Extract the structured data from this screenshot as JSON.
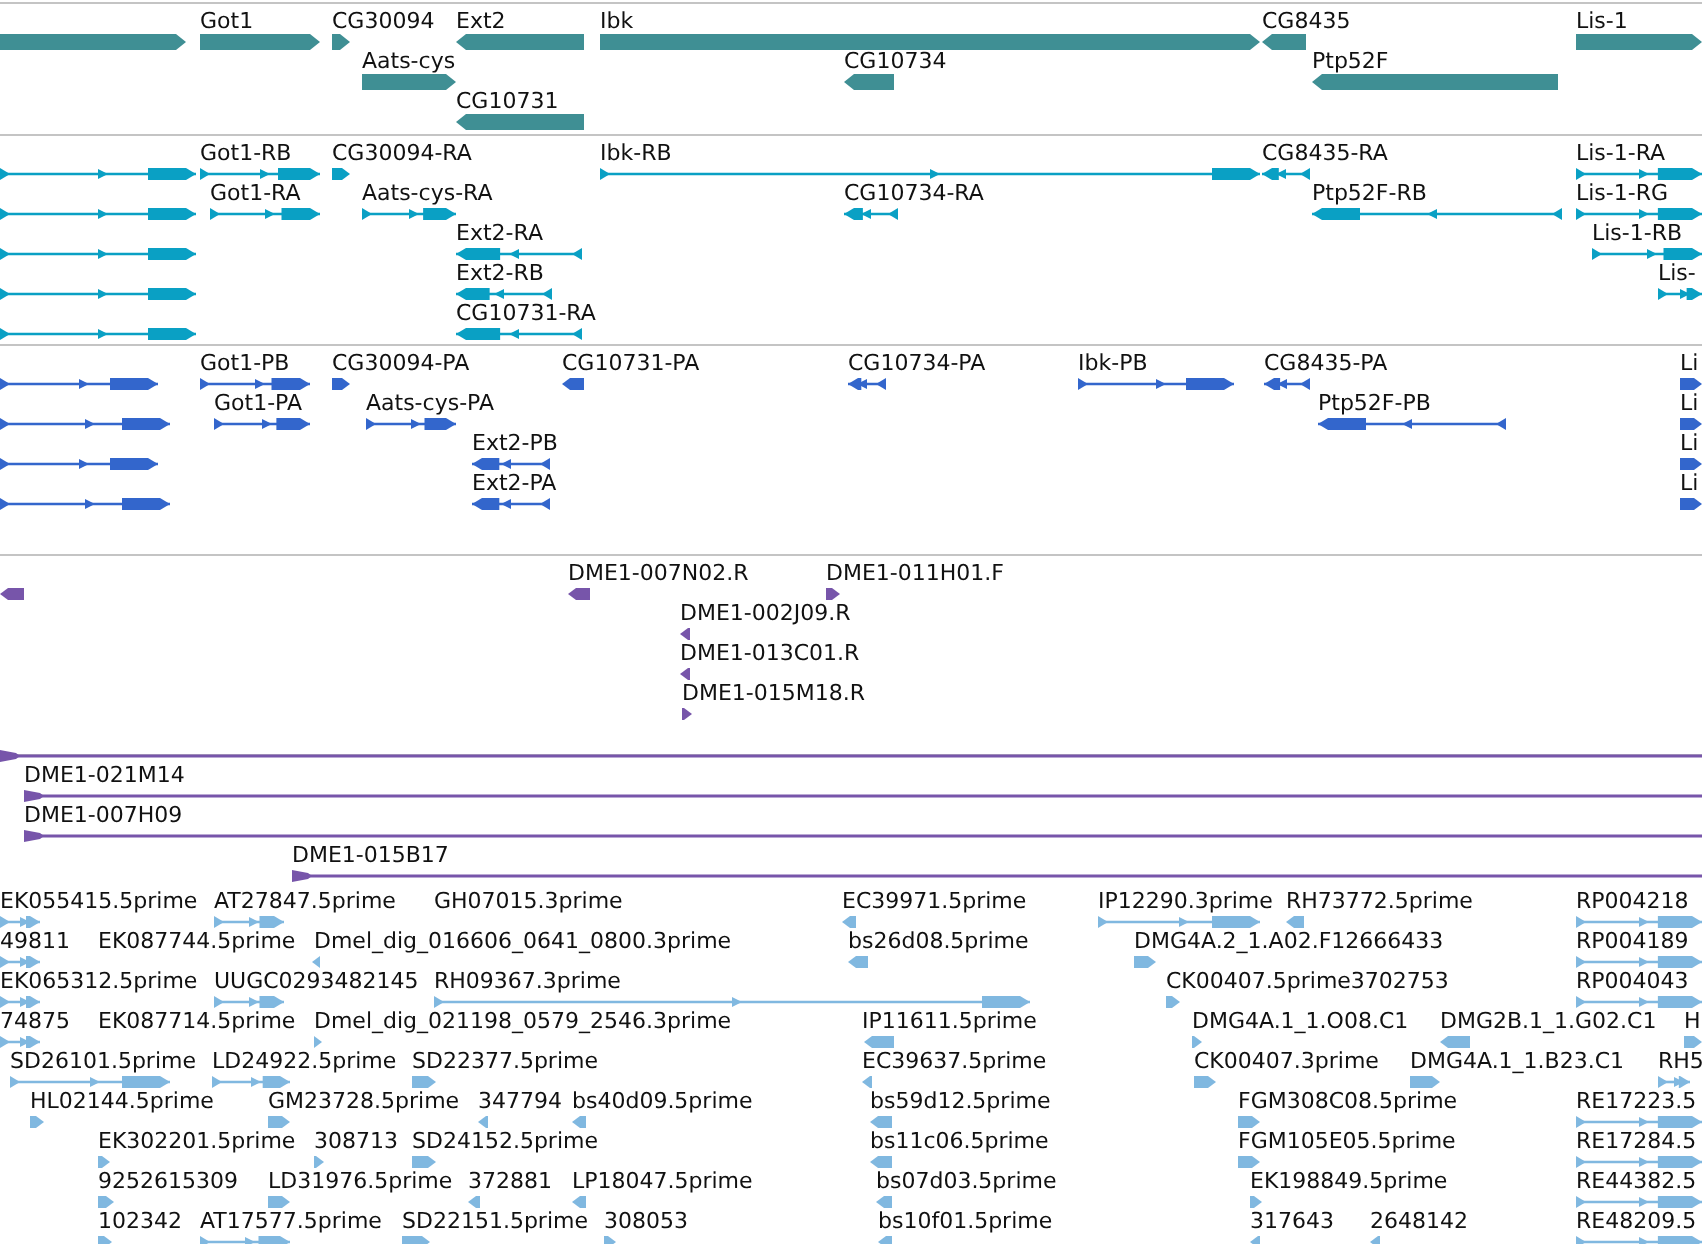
{
  "tracks": [
    {
      "kind": "genes",
      "color": "#3f8f94",
      "features": [
        {
          "forward": true
        },
        {
          "label": "Got1",
          "forward": true
        },
        {
          "label": "CG30094",
          "forward": true
        },
        {
          "label": "Ext2",
          "forward": false
        },
        {
          "label": "Ibk",
          "forward": true
        },
        {
          "label": "CG8435",
          "forward": false
        },
        {
          "label": "Lis-1",
          "forward": true
        },
        {
          "label": "Aats-cys",
          "forward": true
        },
        {
          "label": "CG10734",
          "forward": false
        },
        {
          "label": "Ptp52F",
          "forward": false
        },
        {
          "label": "CG10731",
          "forward": false
        }
      ]
    },
    {
      "kind": "transcripts",
      "color": "#0aa0c4",
      "features": [
        {
          "forward": true
        },
        {
          "forward": true
        },
        {
          "forward": true
        },
        {
          "forward": true
        },
        {
          "forward": true
        },
        {
          "label": "Got1-RB",
          "forward": true
        },
        {
          "label": "CG30094-RA",
          "forward": true
        },
        {
          "label": "Ibk-RB",
          "forward": true
        },
        {
          "label": "CG8435-RA",
          "forward": false
        },
        {
          "label": "Lis-1-RA",
          "forward": true
        },
        {
          "label": "Got1-RA",
          "forward": true
        },
        {
          "label": "Aats-cys-RA",
          "forward": true
        },
        {
          "label": "CG10734-RA",
          "forward": false
        },
        {
          "label": "Ptp52F-RB",
          "forward": false
        },
        {
          "label": "Lis-1-RG",
          "forward": true
        },
        {
          "label": "Ext2-RA",
          "forward": false
        },
        {
          "label": "Lis-1-RB",
          "forward": true
        },
        {
          "label": "Ext2-RB",
          "forward": false
        },
        {
          "label": "Lis-",
          "forward": true
        },
        {
          "label": "CG10731-RA",
          "forward": false
        }
      ]
    },
    {
      "kind": "proteins",
      "color": "#3366cc",
      "features": [
        {
          "forward": true
        },
        {
          "forward": true
        },
        {
          "forward": true
        },
        {
          "forward": true
        },
        {
          "label": "Got1-PB",
          "forward": true
        },
        {
          "label": "CG30094-PA",
          "forward": true
        },
        {
          "label": "CG10731-PA",
          "forward": false
        },
        {
          "label": "CG10734-PA",
          "forward": false
        },
        {
          "label": "Ibk-PB",
          "forward": true
        },
        {
          "label": "CG8435-PA",
          "forward": false
        },
        {
          "label": "Li",
          "forward": true
        },
        {
          "label": "Got1-PA",
          "forward": true
        },
        {
          "label": "Aats-cys-PA",
          "forward": true
        },
        {
          "label": "Ptp52F-PB",
          "forward": false
        },
        {
          "label": "Li",
          "forward": true
        },
        {
          "label": "Ext2-PB",
          "forward": false
        },
        {
          "label": "Li",
          "forward": true
        },
        {
          "label": "Ext2-PA",
          "forward": false
        },
        {
          "label": "Li",
          "forward": true
        }
      ]
    },
    {
      "kind": "bacends",
      "color": "#7755aa",
      "features": [
        {
          "forward": false
        },
        {
          "label": "DME1-007N02.R",
          "forward": false
        },
        {
          "label": "DME1-011H01.F",
          "forward": true
        },
        {
          "label": "DME1-002J09.R",
          "forward": false
        },
        {
          "label": "DME1-013C01.R",
          "forward": false
        },
        {
          "label": "DME1-015M18.R",
          "forward": true
        }
      ]
    },
    {
      "kind": "clones",
      "color": "#7755aa",
      "features": [
        {
          "forward": true
        },
        {
          "label": "DME1-021M14",
          "forward": true
        },
        {
          "label": "DME1-007H09",
          "forward": true
        },
        {
          "label": "DME1-015B17",
          "forward": true
        }
      ]
    },
    {
      "kind": "ests",
      "color": "#80b8e0",
      "features": [
        {
          "label": "EK055415.5prime",
          "forward": true
        },
        {
          "label": "AT27847.5prime",
          "forward": true
        },
        {
          "label": "GH07015.3prime"
        },
        {
          "label": "EC39971.5prime",
          "forward": false
        },
        {
          "label": "IP12290.3prime",
          "forward": true
        },
        {
          "label": "RH73772.5prime",
          "forward": false
        },
        {
          "label": "RP004218",
          "forward": true
        },
        {
          "label": "49811",
          "forward": true
        },
        {
          "label": "EK087744.5prime"
        },
        {
          "label": "Dmel_dig_016606_0641_0800.3prime",
          "forward": false
        },
        {
          "label": "bs26d08.5prime",
          "forward": false
        },
        {
          "label": "DMG4A.2_1.A02.F12666433",
          "forward": true
        },
        {
          "label": "RP004189",
          "forward": true
        },
        {
          "label": "EK065312.5prime",
          "forward": true
        },
        {
          "label": "UUGC0293482145",
          "forward": true
        },
        {
          "label": "RH09367.3prime",
          "forward": true
        },
        {
          "label": "CK00407.5prime3702753",
          "forward": true
        },
        {
          "label": "RP004043",
          "forward": true
        },
        {
          "label": "74875",
          "forward": true
        },
        {
          "label": "EK087714.5prime"
        },
        {
          "label": "Dmel_dig_021198_0579_2546.3prime",
          "forward": true
        },
        {
          "label": "IP11611.5prime",
          "forward": false
        },
        {
          "label": "DMG4A.1_1.O08.C1",
          "forward": true
        },
        {
          "label": "DMG2B.1_1.G02.C1",
          "forward": false
        },
        {
          "label": "H",
          "forward": true
        },
        {
          "label": "SD26101.5prime",
          "forward": true
        },
        {
          "label": "LD24922.5prime",
          "forward": true
        },
        {
          "label": "SD22377.5prime",
          "forward": true
        },
        {
          "label": "EC39637.5prime",
          "forward": false
        },
        {
          "label": "CK00407.3prime",
          "forward": true
        },
        {
          "label": "DMG4A.1_1.B23.C1",
          "forward": true
        },
        {
          "label": "RH5",
          "forward": true
        },
        {
          "label": "HL02144.5prime",
          "forward": true
        },
        {
          "label": "GM23728.5prime",
          "forward": true
        },
        {
          "label": "347794",
          "forward": false
        },
        {
          "label": "bs40d09.5prime",
          "forward": false
        },
        {
          "label": "bs59d12.5prime",
          "forward": false
        },
        {
          "label": "FGM308C08.5prime",
          "forward": true
        },
        {
          "label": "RE17223.5",
          "forward": true
        },
        {
          "label": "EK302201.5prime",
          "forward": true
        },
        {
          "label": "308713",
          "forward": true
        },
        {
          "label": "SD24152.5prime",
          "forward": true
        },
        {
          "label": "bs11c06.5prime",
          "forward": false
        },
        {
          "label": "FGM105E05.5prime",
          "forward": true
        },
        {
          "label": "RE17284.5",
          "forward": true
        },
        {
          "label": "9252615309",
          "forward": true
        },
        {
          "label": "LD31976.5prime",
          "forward": true
        },
        {
          "label": "372881",
          "forward": false
        },
        {
          "label": "LP18047.5prime",
          "forward": false
        },
        {
          "label": "bs07d03.5prime",
          "forward": false
        },
        {
          "label": "EK198849.5prime",
          "forward": true
        },
        {
          "label": "RE44382.5",
          "forward": true
        },
        {
          "label": "102342",
          "forward": true
        },
        {
          "label": "AT17577.5prime",
          "forward": true
        },
        {
          "label": "SD22151.5prime",
          "forward": true
        },
        {
          "label": "308053",
          "forward": true
        },
        {
          "label": "bs10f01.5prime",
          "forward": false
        },
        {
          "label": "317643",
          "forward": false
        },
        {
          "label": "2648142",
          "forward": false
        },
        {
          "label": "RE48209.5",
          "forward": true
        }
      ]
    }
  ]
}
